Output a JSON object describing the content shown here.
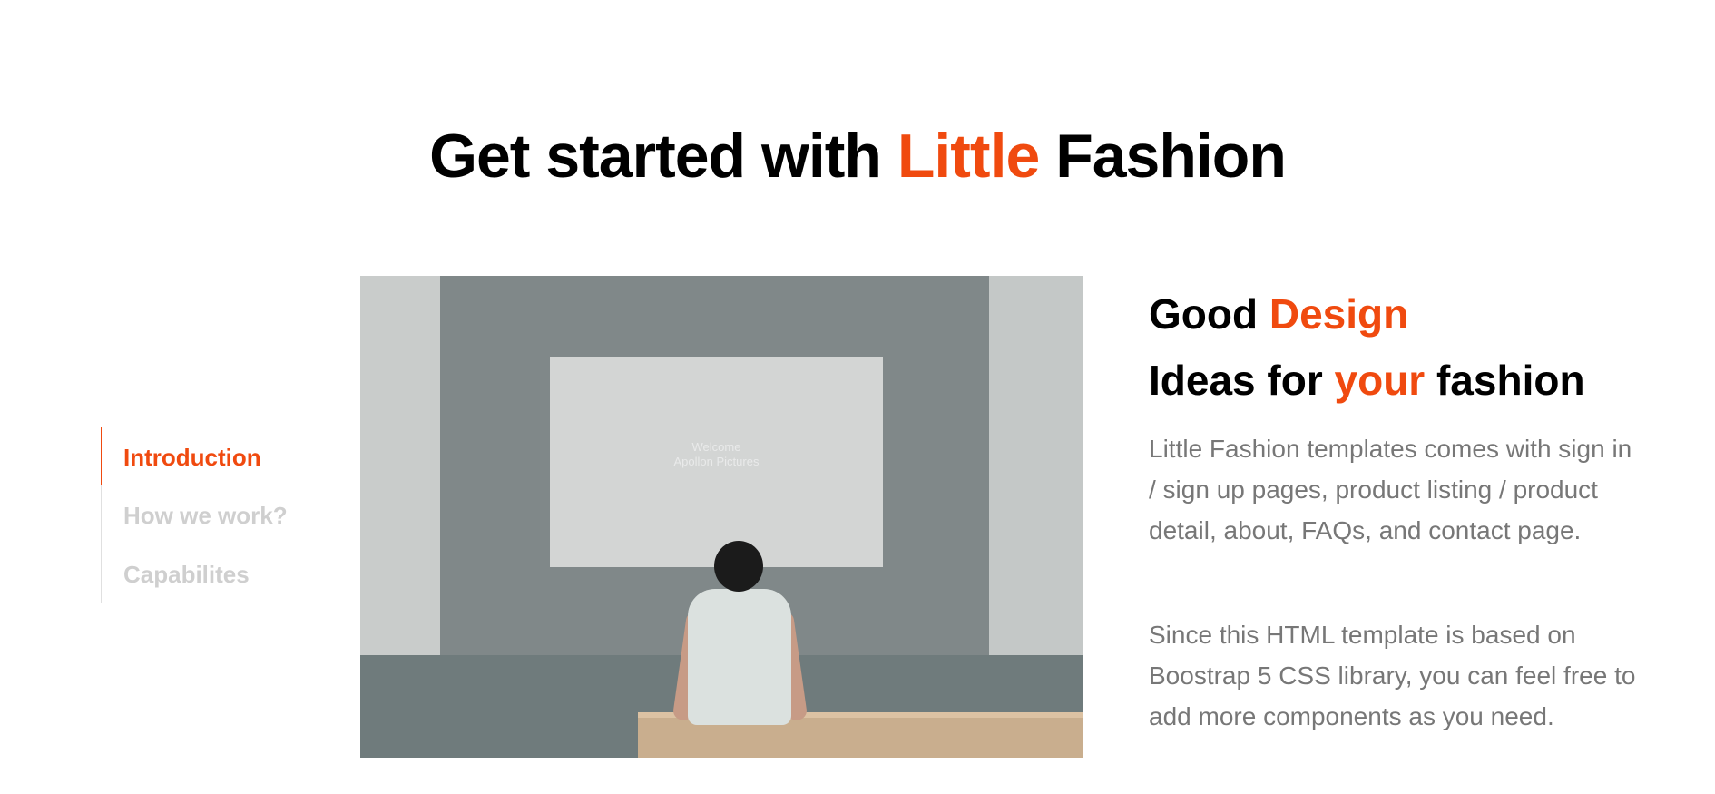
{
  "header": {
    "title_prefix": "Get started with",
    "title_accent": "Little",
    "title_suffix": "Fashion"
  },
  "side_nav": {
    "items": [
      {
        "label": "Introduction",
        "active": true
      },
      {
        "label": "How we work?",
        "active": false
      },
      {
        "label": "Capabilites",
        "active": false
      }
    ]
  },
  "image": {
    "screen_text_line1": "Welcome",
    "screen_text_line2": "Apollon Pictures"
  },
  "content": {
    "heading_line1_prefix": "Good",
    "heading_line1_accent": "Design",
    "heading_line2_prefix": "Ideas for",
    "heading_line2_accent": "your",
    "heading_line2_suffix": "fashion",
    "paragraph1": "Little Fashion templates comes with sign in / sign up pages, product listing / product detail, about, FAQs, and contact page.",
    "paragraph2": "Since this HTML template is based on Boostrap 5 CSS library, you can feel free to add more components as you need."
  },
  "colors": {
    "accent": "#f04a0f",
    "inactive_nav": "#cfcfcf",
    "body_text": "#777777"
  }
}
